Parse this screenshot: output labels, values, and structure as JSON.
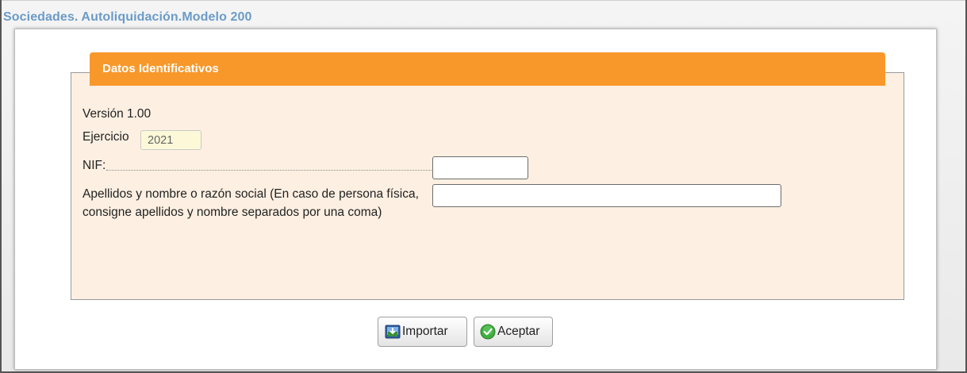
{
  "app": {
    "title": "Sociedades. Autoliquidación.Modelo 200"
  },
  "section": {
    "legend": "Datos Identificativos"
  },
  "fields": {
    "version_text": "Versión 1.00",
    "ejercicio_label": "Ejercicio",
    "ejercicio_value": "2021",
    "nif_label": "NIF:",
    "nif_value": "",
    "razon_label": "Apellidos y nombre o razón social (En caso de persona física, consigne apellidos y nombre separados por una coma)",
    "razon_value": ""
  },
  "buttons": {
    "importar_label": "Importar",
    "aceptar_label": "Aceptar"
  },
  "colors": {
    "accent_orange": "#f8982a",
    "panel_background": "#fdf0e2",
    "title_blue": "#6b9bc8"
  },
  "icons": {
    "importar": "import-icon",
    "aceptar": "check-circle-icon"
  }
}
